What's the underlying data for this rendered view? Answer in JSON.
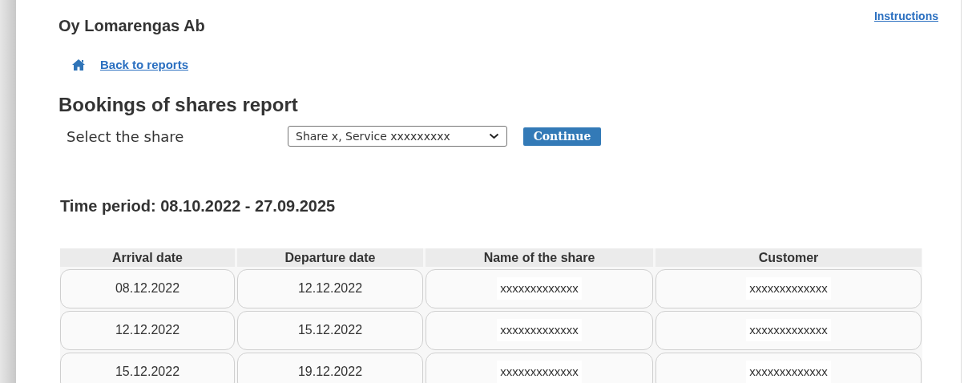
{
  "company": "Oy Lomarengas Ab",
  "instructions_link": "Instructions",
  "back_link": "Back to reports",
  "title": "Bookings of shares report",
  "share_select": {
    "label": "Select the share",
    "value": "Share x, Service xxxxxxxxx"
  },
  "continue_button": "Continue",
  "time_period": "Time period: 08.10.2022 - 27.09.2025",
  "table": {
    "columns": [
      "Arrival date",
      "Departure date",
      "Name of the share",
      "Customer"
    ],
    "rows": [
      [
        "08.12.2022",
        "12.12.2022",
        "xxxxxxxxxxxxx",
        "xxxxxxxxxxxxx"
      ],
      [
        "12.12.2022",
        "15.12.2022",
        "xxxxxxxxxxxxx",
        "xxxxxxxxxxxxx"
      ],
      [
        "15.12.2022",
        "19.12.2022",
        "xxxxxxxxxxxxx",
        "xxxxxxxxxxxxx"
      ]
    ]
  }
}
